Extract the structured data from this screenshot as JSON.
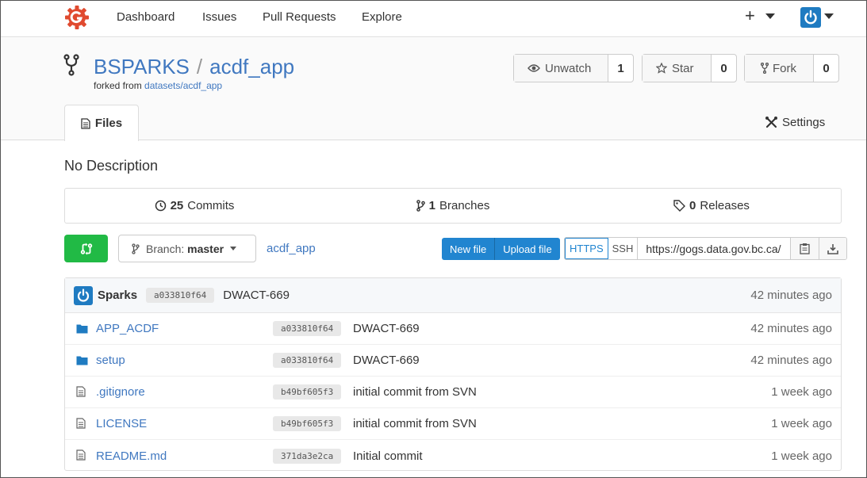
{
  "nav": {
    "items": [
      "Dashboard",
      "Issues",
      "Pull Requests",
      "Explore"
    ],
    "plus": "+"
  },
  "repo": {
    "owner": "BSPARKS",
    "separator": "/",
    "name": "acdf_app",
    "forked_prefix": "forked from",
    "forked_link": "datasets/acdf_app",
    "unwatch_label": "Unwatch",
    "watch_count": "1",
    "star_label": "Star",
    "star_count": "0",
    "fork_label": "Fork",
    "fork_count": "0"
  },
  "tabs": {
    "files": "Files",
    "settings": "Settings"
  },
  "description": "No Description",
  "stats": {
    "commits_count": "25",
    "commits_label": "Commits",
    "branches_count": "1",
    "branches_label": "Branches",
    "releases_count": "0",
    "releases_label": "Releases"
  },
  "toolbar": {
    "branch_prefix": "Branch:",
    "branch_name": "master",
    "breadcrumb": "acdf_app",
    "new_file": "New file",
    "upload_file": "Upload file",
    "https": "HTTPS",
    "ssh": "SSH",
    "clone_url": "https://gogs.data.gov.bc.ca/"
  },
  "latest_commit": {
    "author": "Sparks",
    "sha": "a033810f64",
    "message": "DWACT-669",
    "when": "42 minutes ago"
  },
  "files": [
    {
      "type": "folder",
      "name": "APP_ACDF",
      "sha": "a033810f64",
      "message": "DWACT-669",
      "when": "42 minutes ago"
    },
    {
      "type": "folder",
      "name": "setup",
      "sha": "a033810f64",
      "message": "DWACT-669",
      "when": "42 minutes ago"
    },
    {
      "type": "file",
      "name": ".gitignore",
      "sha": "b49bf605f3",
      "message": "initial commit from SVN",
      "when": "1 week ago"
    },
    {
      "type": "file",
      "name": "LICENSE",
      "sha": "b49bf605f3",
      "message": "initial commit from SVN",
      "when": "1 week ago"
    },
    {
      "type": "file",
      "name": "README.md",
      "sha": "371da3e2ca",
      "message": "Initial commit",
      "when": "1 week ago"
    }
  ],
  "colors": {
    "link": "#4078c0",
    "primary": "#2185d0",
    "green": "#21ba45",
    "logo": "#e04a2f"
  }
}
